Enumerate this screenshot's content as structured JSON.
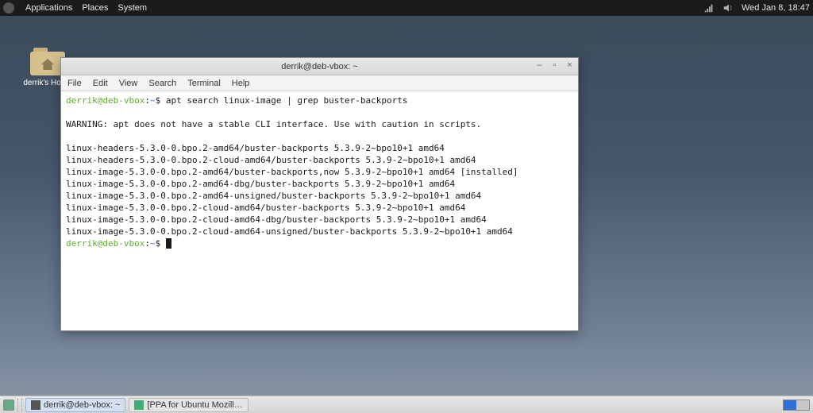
{
  "panel": {
    "menus": [
      "Applications",
      "Places",
      "System"
    ],
    "clock": "Wed Jan  8, 18:47"
  },
  "desktop": {
    "home_label": "derrik's Home"
  },
  "window": {
    "title": "derrik@deb-vbox: ~",
    "controls": {
      "minimize": "–",
      "maximize": "▫",
      "close": "×"
    },
    "menus": [
      "File",
      "Edit",
      "View",
      "Search",
      "Terminal",
      "Help"
    ]
  },
  "prompt": {
    "userhost": "derrik@deb-vbox",
    "sep": ":",
    "path": "~",
    "sigil": "$"
  },
  "command": "apt search linux-image | grep buster-backports",
  "output": [
    "",
    "WARNING: apt does not have a stable CLI interface. Use with caution in scripts.",
    "",
    "linux-headers-5.3.0-0.bpo.2-amd64/buster-backports 5.3.9-2~bpo10+1 amd64",
    "linux-headers-5.3.0-0.bpo.2-cloud-amd64/buster-backports 5.3.9-2~bpo10+1 amd64",
    "linux-image-5.3.0-0.bpo.2-amd64/buster-backports,now 5.3.9-2~bpo10+1 amd64 [installed]",
    "linux-image-5.3.0-0.bpo.2-amd64-dbg/buster-backports 5.3.9-2~bpo10+1 amd64",
    "linux-image-5.3.0-0.bpo.2-amd64-unsigned/buster-backports 5.3.9-2~bpo10+1 amd64",
    "linux-image-5.3.0-0.bpo.2-cloud-amd64/buster-backports 5.3.9-2~bpo10+1 amd64",
    "linux-image-5.3.0-0.bpo.2-cloud-amd64-dbg/buster-backports 5.3.9-2~bpo10+1 amd64",
    "linux-image-5.3.0-0.bpo.2-cloud-amd64-unsigned/buster-backports 5.3.9-2~bpo10+1 amd64"
  ],
  "taskbar": {
    "items": [
      {
        "label": "derrik@deb-vbox: ~",
        "active": true
      },
      {
        "label": "[PPA for Ubuntu Mozill…",
        "active": false
      }
    ]
  }
}
